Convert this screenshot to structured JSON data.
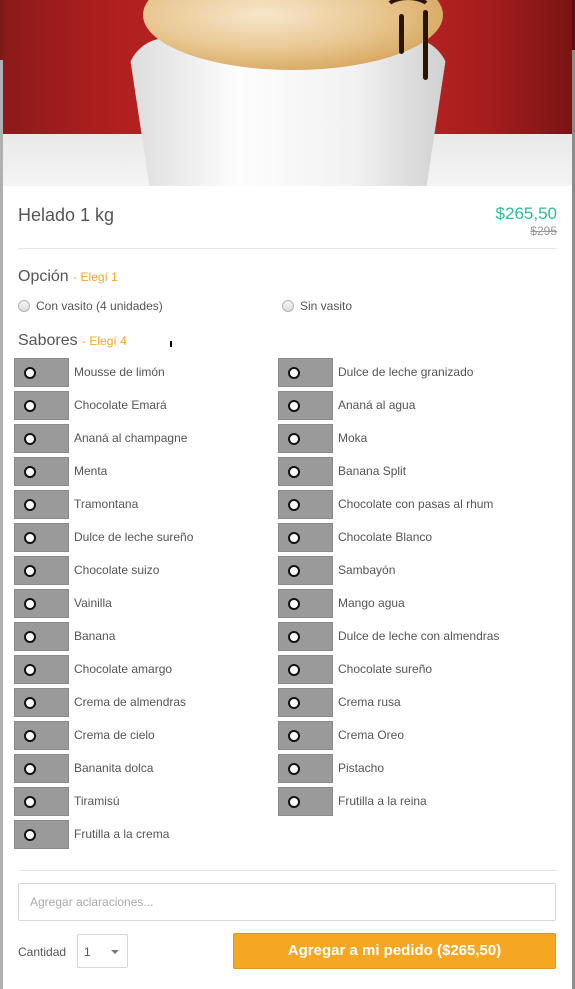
{
  "product": {
    "title": "Helado 1 kg",
    "price": "$265,50",
    "old_price": "$295"
  },
  "opcion": {
    "title": "Opción",
    "hint": "- Elegí 1",
    "options": [
      "Con vasito (4 unidades)",
      "Sin vasito"
    ]
  },
  "sabores": {
    "title": "Sabores",
    "hint": "- Elegí 4",
    "left": [
      "Mousse de limón",
      "Chocolate Emará",
      "Ananá al champagne",
      "Menta",
      "Tramontana",
      "Dulce de leche sureño",
      "Chocolate suizo",
      "Vainilla",
      "Banana",
      "Chocolate amargo",
      "Crema de almendras",
      "Crema de cielo",
      "Bananita dolca",
      "Tiramisú",
      "Frutilla a la crema"
    ],
    "right": [
      "Dulce de leche granizado",
      "Ananá al agua",
      "Moka",
      "Banana Split",
      "Chocolate con pasas al rhum",
      "Chocolate Blanco",
      "Sambayón",
      "Mango agua",
      "Dulce de leche con almendras",
      "Chocolate sureño",
      "Crema rusa",
      "Crema Oreo",
      "Pistacho",
      "Frutilla a la reina"
    ]
  },
  "notes_placeholder": "Agregar aclaraciones...",
  "quantity": {
    "label": "Cantidad",
    "value": "1"
  },
  "add_button": "Agregar a mi pedido ($265,50)",
  "colors": {
    "price": "#2bbd9c",
    "accent": "#f5a623"
  }
}
